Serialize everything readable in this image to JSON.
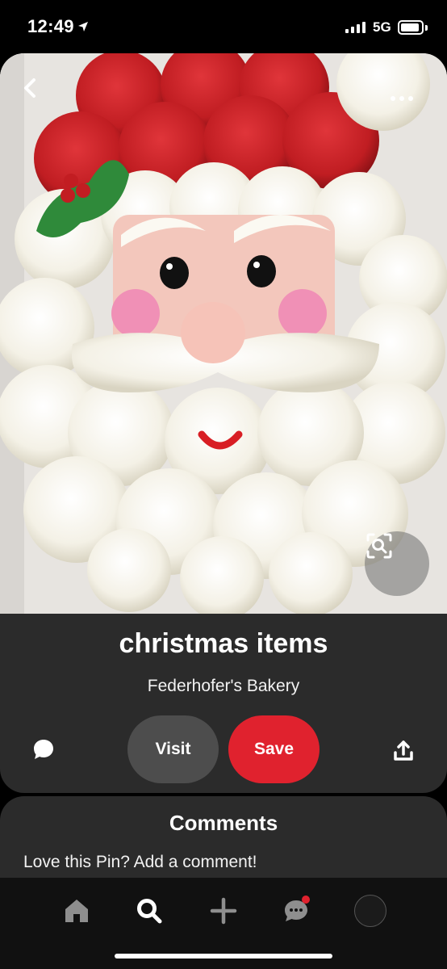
{
  "status_bar": {
    "time": "12:49",
    "network": "5G",
    "battery_level": 0.9
  },
  "pin": {
    "image_alt": "Santa face cupcake cake",
    "title": "christmas items",
    "author": "Federhofer's Bakery",
    "visit_label": "Visit",
    "save_label": "Save"
  },
  "comments": {
    "heading": "Comments",
    "prompt": "Love this Pin? Add a comment!"
  },
  "icons": {
    "back": "chevron-left-icon",
    "more": "more-dots-icon",
    "lens": "visual-search-icon",
    "comment": "speech-bubble-icon",
    "share": "share-upload-icon",
    "home": "home-icon",
    "search": "search-icon",
    "create": "plus-icon",
    "messages": "chat-bubble-icon",
    "profile": "profile-avatar"
  },
  "colors": {
    "accent": "#e0222e",
    "card": "#2b2b2b",
    "background": "#000000"
  }
}
